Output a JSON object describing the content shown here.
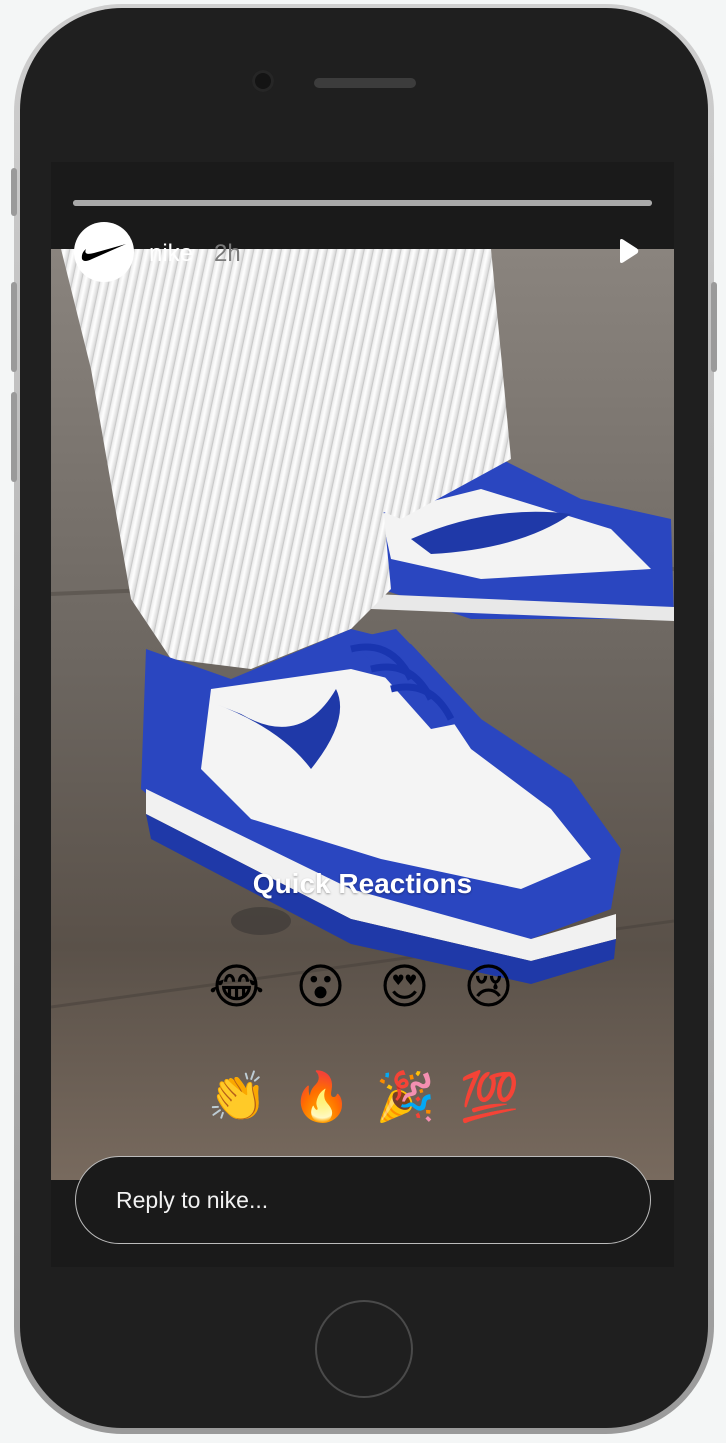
{
  "story": {
    "username": "nike",
    "timestamp": "2h",
    "progress": 1.0,
    "avatar_icon": "nike-swoosh-icon"
  },
  "reactions": {
    "title": "Quick Reactions",
    "row1": [
      {
        "emoji": "😂",
        "name": "laugh-cry-emoji"
      },
      {
        "emoji": "😮",
        "name": "surprised-emoji"
      },
      {
        "emoji": "😍",
        "name": "heart-eyes-emoji"
      },
      {
        "emoji": "😢",
        "name": "crying-emoji"
      }
    ],
    "row2": [
      {
        "emoji": "👏",
        "name": "clap-emoji"
      },
      {
        "emoji": "🔥",
        "name": "fire-emoji"
      },
      {
        "emoji": "🎉",
        "name": "party-emoji"
      },
      {
        "emoji": "💯",
        "name": "hundred-emoji"
      }
    ]
  },
  "reply": {
    "placeholder": "Reply to nike..."
  },
  "colors": {
    "shoe_blue": "#2340b7",
    "screen_bg": "#1a1a1a"
  }
}
